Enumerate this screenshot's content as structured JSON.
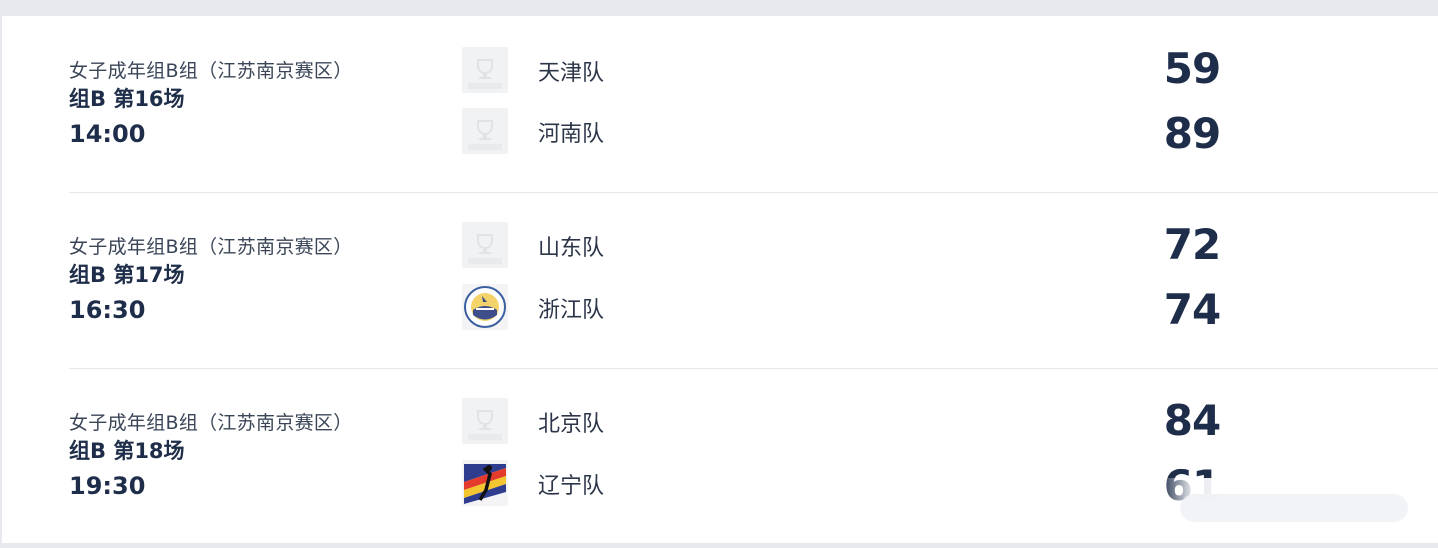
{
  "matches": [
    {
      "competition": "女子成年组B组（江苏南京赛区）",
      "round": "组B 第16场",
      "time": "14:00",
      "home": {
        "name": "天津队",
        "logo": "placeholder-logo-icon",
        "score": "59"
      },
      "away": {
        "name": "河南队",
        "logo": "placeholder-logo-icon",
        "score": "89"
      }
    },
    {
      "competition": "女子成年组B组（江苏南京赛区）",
      "round": "组B 第17场",
      "time": "16:30",
      "home": {
        "name": "山东队",
        "logo": "placeholder-logo-icon",
        "score": "72"
      },
      "away": {
        "name": "浙江队",
        "logo": "zhejiang-team-logo-icon",
        "score": "74"
      }
    },
    {
      "competition": "女子成年组B组（江苏南京赛区）",
      "round": "组B 第18场",
      "time": "19:30",
      "home": {
        "name": "北京队",
        "logo": "placeholder-logo-icon",
        "score": "84"
      },
      "away": {
        "name": "辽宁队",
        "logo": "liaoning-team-logo-icon",
        "score": "61"
      }
    }
  ],
  "colors": {
    "background": "#e7e9ee",
    "card": "#ffffff",
    "primary_text": "#1e2d4a",
    "secondary_text": "#3a4658",
    "divider": "#e6e8ec"
  }
}
